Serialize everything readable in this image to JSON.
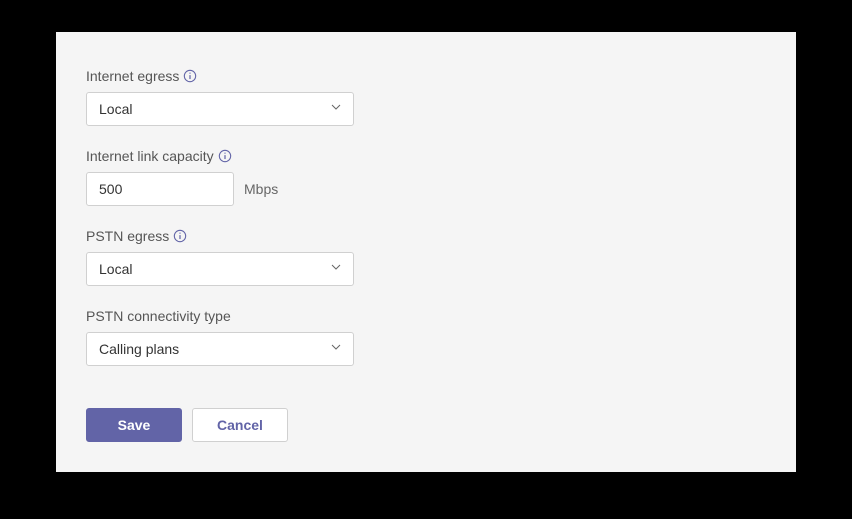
{
  "fields": {
    "internet_egress": {
      "label": "Internet egress",
      "value": "Local",
      "has_info": true
    },
    "internet_link_capacity": {
      "label": "Internet link capacity",
      "value": "500",
      "unit": "Mbps",
      "has_info": true
    },
    "pstn_egress": {
      "label": "PSTN egress",
      "value": "Local",
      "has_info": true
    },
    "pstn_connectivity_type": {
      "label": "PSTN connectivity type",
      "value": "Calling plans",
      "has_info": false
    }
  },
  "buttons": {
    "save": "Save",
    "cancel": "Cancel"
  },
  "colors": {
    "accent": "#6264a7",
    "panel_bg": "#f5f5f5"
  }
}
